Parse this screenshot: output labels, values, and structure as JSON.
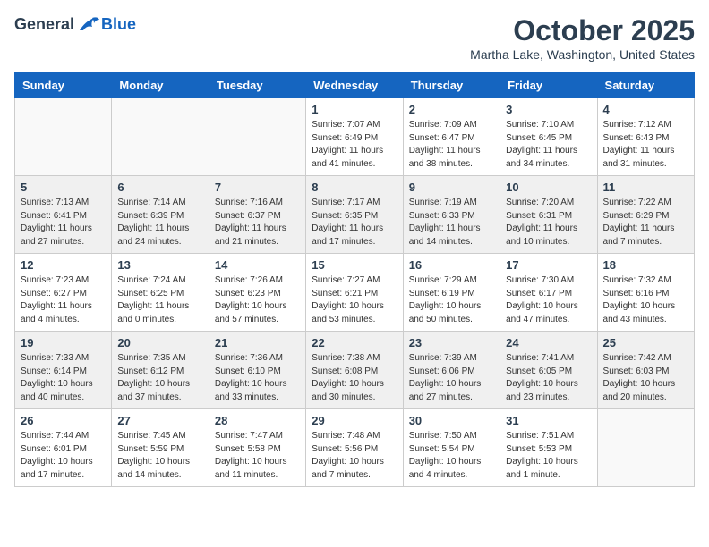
{
  "header": {
    "logo_general": "General",
    "logo_blue": "Blue",
    "month_title": "October 2025",
    "location": "Martha Lake, Washington, United States"
  },
  "days_of_week": [
    "Sunday",
    "Monday",
    "Tuesday",
    "Wednesday",
    "Thursday",
    "Friday",
    "Saturday"
  ],
  "weeks": [
    [
      {
        "day": "",
        "info": ""
      },
      {
        "day": "",
        "info": ""
      },
      {
        "day": "",
        "info": ""
      },
      {
        "day": "1",
        "info": "Sunrise: 7:07 AM\nSunset: 6:49 PM\nDaylight: 11 hours\nand 41 minutes."
      },
      {
        "day": "2",
        "info": "Sunrise: 7:09 AM\nSunset: 6:47 PM\nDaylight: 11 hours\nand 38 minutes."
      },
      {
        "day": "3",
        "info": "Sunrise: 7:10 AM\nSunset: 6:45 PM\nDaylight: 11 hours\nand 34 minutes."
      },
      {
        "day": "4",
        "info": "Sunrise: 7:12 AM\nSunset: 6:43 PM\nDaylight: 11 hours\nand 31 minutes."
      }
    ],
    [
      {
        "day": "5",
        "info": "Sunrise: 7:13 AM\nSunset: 6:41 PM\nDaylight: 11 hours\nand 27 minutes."
      },
      {
        "day": "6",
        "info": "Sunrise: 7:14 AM\nSunset: 6:39 PM\nDaylight: 11 hours\nand 24 minutes."
      },
      {
        "day": "7",
        "info": "Sunrise: 7:16 AM\nSunset: 6:37 PM\nDaylight: 11 hours\nand 21 minutes."
      },
      {
        "day": "8",
        "info": "Sunrise: 7:17 AM\nSunset: 6:35 PM\nDaylight: 11 hours\nand 17 minutes."
      },
      {
        "day": "9",
        "info": "Sunrise: 7:19 AM\nSunset: 6:33 PM\nDaylight: 11 hours\nand 14 minutes."
      },
      {
        "day": "10",
        "info": "Sunrise: 7:20 AM\nSunset: 6:31 PM\nDaylight: 11 hours\nand 10 minutes."
      },
      {
        "day": "11",
        "info": "Sunrise: 7:22 AM\nSunset: 6:29 PM\nDaylight: 11 hours\nand 7 minutes."
      }
    ],
    [
      {
        "day": "12",
        "info": "Sunrise: 7:23 AM\nSunset: 6:27 PM\nDaylight: 11 hours\nand 4 minutes."
      },
      {
        "day": "13",
        "info": "Sunrise: 7:24 AM\nSunset: 6:25 PM\nDaylight: 11 hours\nand 0 minutes."
      },
      {
        "day": "14",
        "info": "Sunrise: 7:26 AM\nSunset: 6:23 PM\nDaylight: 10 hours\nand 57 minutes."
      },
      {
        "day": "15",
        "info": "Sunrise: 7:27 AM\nSunset: 6:21 PM\nDaylight: 10 hours\nand 53 minutes."
      },
      {
        "day": "16",
        "info": "Sunrise: 7:29 AM\nSunset: 6:19 PM\nDaylight: 10 hours\nand 50 minutes."
      },
      {
        "day": "17",
        "info": "Sunrise: 7:30 AM\nSunset: 6:17 PM\nDaylight: 10 hours\nand 47 minutes."
      },
      {
        "day": "18",
        "info": "Sunrise: 7:32 AM\nSunset: 6:16 PM\nDaylight: 10 hours\nand 43 minutes."
      }
    ],
    [
      {
        "day": "19",
        "info": "Sunrise: 7:33 AM\nSunset: 6:14 PM\nDaylight: 10 hours\nand 40 minutes."
      },
      {
        "day": "20",
        "info": "Sunrise: 7:35 AM\nSunset: 6:12 PM\nDaylight: 10 hours\nand 37 minutes."
      },
      {
        "day": "21",
        "info": "Sunrise: 7:36 AM\nSunset: 6:10 PM\nDaylight: 10 hours\nand 33 minutes."
      },
      {
        "day": "22",
        "info": "Sunrise: 7:38 AM\nSunset: 6:08 PM\nDaylight: 10 hours\nand 30 minutes."
      },
      {
        "day": "23",
        "info": "Sunrise: 7:39 AM\nSunset: 6:06 PM\nDaylight: 10 hours\nand 27 minutes."
      },
      {
        "day": "24",
        "info": "Sunrise: 7:41 AM\nSunset: 6:05 PM\nDaylight: 10 hours\nand 23 minutes."
      },
      {
        "day": "25",
        "info": "Sunrise: 7:42 AM\nSunset: 6:03 PM\nDaylight: 10 hours\nand 20 minutes."
      }
    ],
    [
      {
        "day": "26",
        "info": "Sunrise: 7:44 AM\nSunset: 6:01 PM\nDaylight: 10 hours\nand 17 minutes."
      },
      {
        "day": "27",
        "info": "Sunrise: 7:45 AM\nSunset: 5:59 PM\nDaylight: 10 hours\nand 14 minutes."
      },
      {
        "day": "28",
        "info": "Sunrise: 7:47 AM\nSunset: 5:58 PM\nDaylight: 10 hours\nand 11 minutes."
      },
      {
        "day": "29",
        "info": "Sunrise: 7:48 AM\nSunset: 5:56 PM\nDaylight: 10 hours\nand 7 minutes."
      },
      {
        "day": "30",
        "info": "Sunrise: 7:50 AM\nSunset: 5:54 PM\nDaylight: 10 hours\nand 4 minutes."
      },
      {
        "day": "31",
        "info": "Sunrise: 7:51 AM\nSunset: 5:53 PM\nDaylight: 10 hours\nand 1 minute."
      },
      {
        "day": "",
        "info": ""
      }
    ]
  ]
}
